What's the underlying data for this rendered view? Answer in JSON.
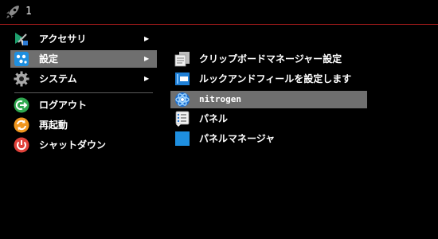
{
  "taskbar": {
    "workspace_label": "1"
  },
  "main_menu": {
    "items": [
      {
        "label": "アクセサリ",
        "icon": "accessories-icon"
      },
      {
        "label": "設定",
        "icon": "settings-icon"
      },
      {
        "label": "システム",
        "icon": "system-gear-icon"
      },
      {
        "label": "ログアウト",
        "icon": "logout-icon"
      },
      {
        "label": "再起動",
        "icon": "reboot-icon"
      },
      {
        "label": "シャットダウン",
        "icon": "shutdown-icon"
      }
    ],
    "submenu_arrow": "▶"
  },
  "settings_submenu": {
    "items": [
      {
        "label": "クリップボードマネージャー設定",
        "icon": "clipboard-icon"
      },
      {
        "label": "ルックアンドフィールを設定します",
        "icon": "appearance-icon"
      },
      {
        "label": "nitrogen",
        "icon": "nitrogen-icon"
      },
      {
        "label": "パネル",
        "icon": "panel-icon"
      },
      {
        "label": "パネルマネージャ",
        "icon": "panel-manager-icon"
      }
    ]
  },
  "colors": {
    "background": "#000000",
    "accent_line": "#b41e1e",
    "selected": "#6f6f6f"
  }
}
